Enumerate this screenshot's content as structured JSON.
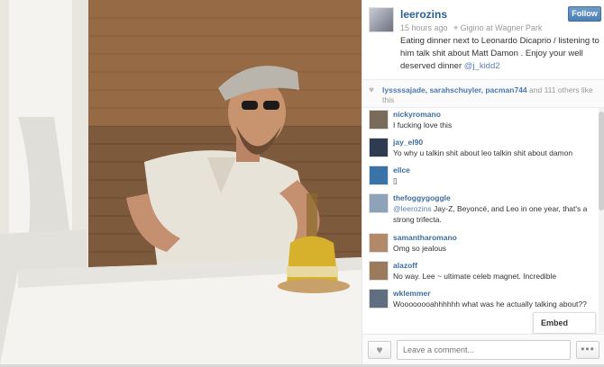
{
  "post": {
    "username": "leerozins",
    "time_ago": "15 hours ago",
    "location": "Gigino at Wagner Park",
    "caption_before": "Eating dinner next to Leonardo Dicaprio / listening to him talk shit about Matt Damon . Enjoy your well deserved dinner",
    "caption_mentions": "@j_kidd2",
    "follow_label": "Follow"
  },
  "likes": {
    "names": "lyssssajade, sarahschuyler, pacman744",
    "rest": "and 111 others like this"
  },
  "comments": [
    {
      "user": "nickyromano",
      "text": "I fucking love this",
      "avatar_color": "#7a6a5a"
    },
    {
      "user": "jay_el90",
      "text": "Yo why u talkin shit about leo talkin shit about damon",
      "avatar_color": "#2f3b4f"
    },
    {
      "user": "ellce",
      "text": "▯",
      "avatar_color": "#3a73a8"
    },
    {
      "user": "thefoggygoggle",
      "mention": "@leerozins",
      "text": "Jay-Z, Beyoncé, and Leo in one year, that's a strong trifecta.",
      "avatar_color": "#8fa3b8"
    },
    {
      "user": "samantharomano",
      "text": "Omg so jealous",
      "avatar_color": "#b08a6a"
    },
    {
      "user": "alazoff",
      "text": "No way. Lee ~ ultimate celeb magnet. Incredible",
      "avatar_color": "#9b7b5c"
    },
    {
      "user": "wklemmer",
      "text": "Woooooooahhhhhh what was he actually talking about??",
      "avatar_color": "#5f6f7f"
    }
  ],
  "popup": {
    "embed_label": "Embed"
  },
  "footer": {
    "comment_placeholder": "Leave a comment...",
    "more_label": "•••"
  },
  "icons": {
    "heart": "heart-icon",
    "pin": "location-pin-icon",
    "more": "more-icon"
  }
}
